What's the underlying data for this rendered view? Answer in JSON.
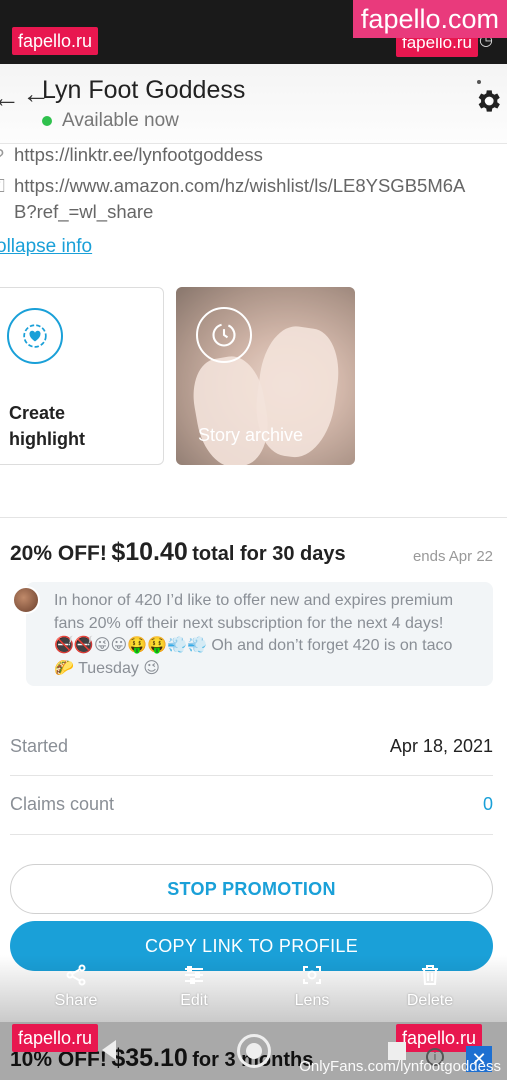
{
  "watermarks": {
    "top_left": "fapello.ru",
    "top_right_big": "fapello.com",
    "top_right_small": "fapello.ru",
    "bottom_left": "fapello.ru",
    "bottom_right": "fapello.ru",
    "credit": "OnlyFans.com/lynfootgoddess"
  },
  "header": {
    "title": "Lyn Foot Goddess",
    "status": "Available now",
    "status_color": "#2fc14d"
  },
  "profile": {
    "links": [
      "https://linktr.ee/lynfootgoddess",
      "https://www.amazon.com/hz/wishlist/ls/LE8YSGB5M6A",
      "B?ref_=wl_share"
    ],
    "collapse_label": "ollapse info"
  },
  "stories": {
    "create_label_line1": "Create",
    "create_label_line2": "highlight",
    "archive_label": "Story archive"
  },
  "promotion": {
    "off": "20% OFF!",
    "price": "$10.40",
    "period": "total for 30 days",
    "ends": "ends Apr 22",
    "message_line1": "In honor of 420 I’d like to offer new and expires premium",
    "message_line2": "fans 20% off their next subscription for the next 4 days!",
    "message_line3": "🚭🚭😜😛🤑🤑💨💨 Oh and don’t forget 420 is on taco",
    "message_line4": "🌮 Tuesday 😉",
    "started_label": "Started",
    "started_value": "Apr 18, 2021",
    "claims_label": "Claims count",
    "claims_value": "0",
    "stop_button": "STOP PROMOTION",
    "copy_button": "COPY LINK TO PROFILE"
  },
  "actions": [
    {
      "label": "Share",
      "icon": "share-icon"
    },
    {
      "label": "Edit",
      "icon": "sliders-icon"
    },
    {
      "label": "Lens",
      "icon": "lens-icon"
    },
    {
      "label": "Delete",
      "icon": "trash-icon"
    }
  ],
  "bottom_promo": {
    "off": "10% OFF!",
    "price": "$35.10",
    "period": "for 3 months"
  },
  "colors": {
    "accent": "#1aa0d8",
    "watermark": "#e8174f"
  }
}
